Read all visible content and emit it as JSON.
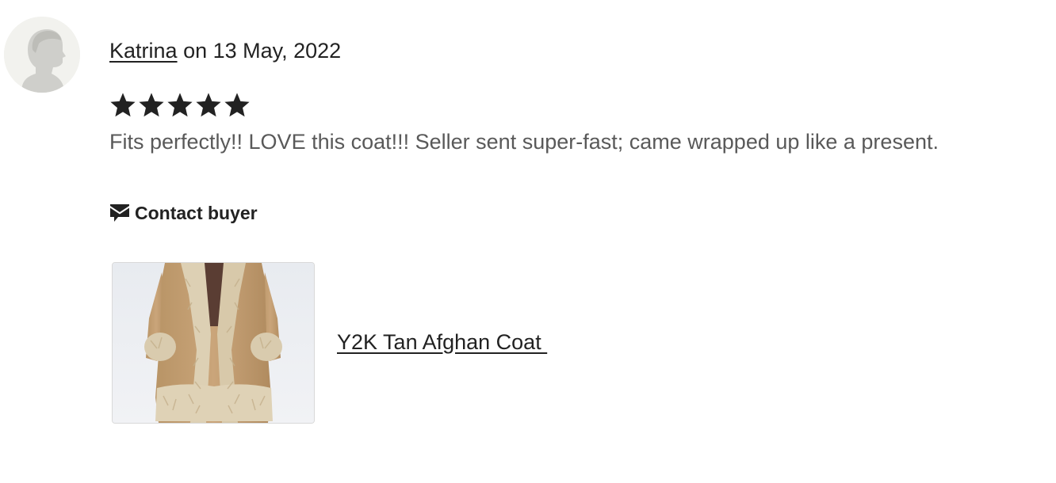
{
  "review": {
    "reviewer_name": "Katrina",
    "date_text": " on 13 May, 2022",
    "rating": 5,
    "rating_max": 5,
    "text": "Fits perfectly!! LOVE this coat!!! Seller sent super-fast; came wrapped up like a present.",
    "contact_label": "Contact buyer",
    "contact_icon": "message-icon",
    "avatar_icon": "default-avatar-silhouette"
  },
  "listing": {
    "title": "Y2K Tan Afghan Coat ",
    "thumbnail": "tan-afghan-coat-photo"
  },
  "colors": {
    "text_primary": "#222222",
    "text_secondary": "#595959",
    "star": "#222222",
    "avatar_bg": "#f2f2ee"
  }
}
